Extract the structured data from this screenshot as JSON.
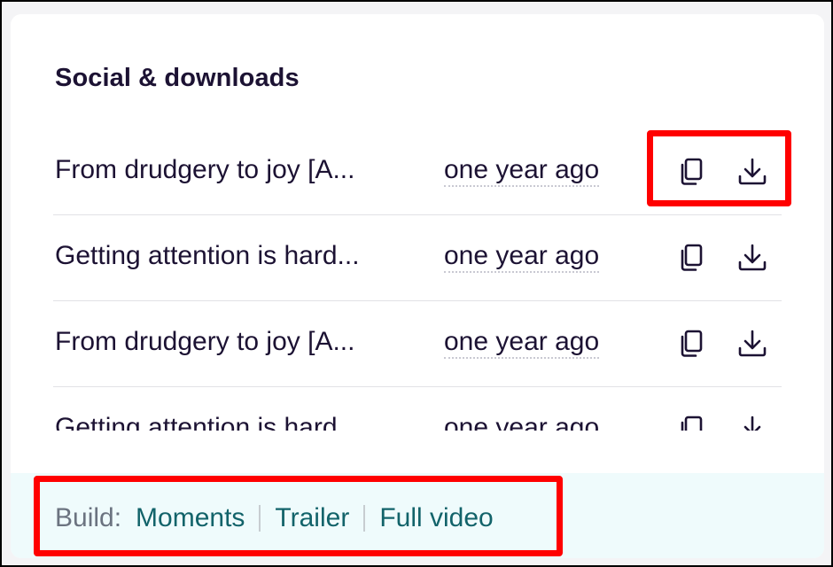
{
  "panel": {
    "title": "Social & downloads"
  },
  "rows": [
    {
      "title": "From drudgery to joy [A...",
      "time": "one year ago",
      "copy_icon": "copy-icon",
      "download_icon": "download-icon"
    },
    {
      "title": "Getting attention is hard...",
      "time": "one year ago",
      "copy_icon": "copy-icon",
      "download_icon": "download-icon"
    },
    {
      "title": "From drudgery to joy [A...",
      "time": "one year ago",
      "copy_icon": "copy-icon",
      "download_icon": "download-icon"
    },
    {
      "title": "Getting attention is hard...",
      "time": "one year ago",
      "copy_icon": "copy-icon",
      "download_icon": "download-icon"
    }
  ],
  "footer": {
    "build_label": "Build:",
    "links": [
      "Moments",
      "Trailer",
      "Full video"
    ]
  },
  "colors": {
    "text": "#1c1233",
    "link": "#12636a",
    "footer_bg": "#effbfc",
    "highlight": "#ff0000"
  }
}
